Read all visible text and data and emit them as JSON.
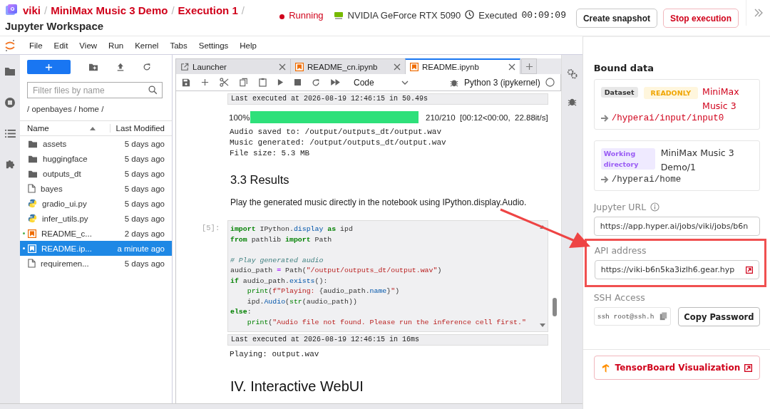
{
  "header": {
    "breadcrumb": [
      {
        "label": "viki",
        "selected": false
      },
      {
        "label": "MiniMax Music 3 Demo",
        "selected": false
      },
      {
        "label": "Execution 1",
        "selected": false
      }
    ],
    "separator": "/",
    "title": "Jupyter Workspace",
    "status": "Running",
    "gpu": "NVIDIA GeForce RTX 5090",
    "executed_label": "Executed",
    "executed_time": "00:09:09",
    "buttons": [
      {
        "label": "Create snapshot",
        "kind": "default"
      },
      {
        "label": "Stop execution",
        "kind": "danger"
      }
    ]
  },
  "menu": [
    "File",
    "Edit",
    "View",
    "Run",
    "Kernel",
    "Tabs",
    "Settings",
    "Help"
  ],
  "file_browser": {
    "filter_placeholder": "Filter files by name",
    "path": "/ openbayes / home /",
    "columns": [
      "Name",
      "Last Modified"
    ],
    "files": [
      {
        "name": "assets",
        "modified": "5 days ago",
        "kind": "folder",
        "selected": false,
        "running": false
      },
      {
        "name": "huggingface",
        "modified": "5 days ago",
        "kind": "folder",
        "selected": false,
        "running": false
      },
      {
        "name": "outputs_dt",
        "modified": "5 days ago",
        "kind": "folder",
        "selected": false,
        "running": false
      },
      {
        "name": "bayes",
        "modified": "5 days ago",
        "kind": "file",
        "selected": false,
        "running": false
      },
      {
        "name": "gradio_ui.py",
        "modified": "5 days ago",
        "kind": "python",
        "selected": false,
        "running": false
      },
      {
        "name": "infer_utils.py",
        "modified": "5 days ago",
        "kind": "python",
        "selected": false,
        "running": false
      },
      {
        "name": "README_c...",
        "modified": "2 days ago",
        "kind": "notebook",
        "selected": false,
        "running": true
      },
      {
        "name": "README.ip...",
        "modified": "a minute ago",
        "kind": "notebook",
        "selected": true,
        "running": true
      },
      {
        "name": "requiremen...",
        "modified": "5 days ago",
        "kind": "file",
        "selected": false,
        "running": false
      }
    ]
  },
  "notebook": {
    "tabs": [
      {
        "label": "Launcher",
        "kind": "launcher",
        "selected": false
      },
      {
        "label": "README_cn.ipynb",
        "kind": "notebook",
        "selected": false
      },
      {
        "label": "README.ipynb",
        "kind": "notebook",
        "selected": true
      }
    ],
    "cell_type": "Code",
    "kernel": "Python 3 (ipykernel)",
    "blocks": [
      {
        "kind": "footer",
        "text": "Last executed at 2026-08-19 12:46:15 in 50.49s"
      },
      {
        "kind": "progress",
        "percent": "100%",
        "level": 1,
        "stats": "210/210  [00:12<00:00,  22.88it/s]"
      },
      {
        "kind": "output",
        "lines": [
          "Audio saved to: /output/outputs_dt/output.wav",
          "Music generated: /output/outputs_dt/output.wav",
          "File size: 5.3 MB"
        ]
      },
      {
        "kind": "heading",
        "text": "3.3 Results"
      },
      {
        "kind": "paragraph",
        "text": "Play the generated music directly in the notebook using IPython.display.Audio."
      },
      {
        "kind": "code",
        "prompt": "[5]:",
        "lines": [
          {
            "kind": "code",
            "tokens": [
              {
                "kind": "kw",
                "text": "import"
              },
              {
                "kind": "plain",
                "text": " IPython."
              },
              {
                "kind": "attr",
                "text": "display"
              },
              {
                "kind": "kw",
                "text": " as"
              },
              {
                "kind": "plain",
                "text": " ipd"
              }
            ]
          },
          {
            "kind": "code",
            "tokens": [
              {
                "kind": "kw",
                "text": "from"
              },
              {
                "kind": "plain",
                "text": " pathlib "
              },
              {
                "kind": "kw",
                "text": "import"
              },
              {
                "kind": "plain",
                "text": " Path"
              }
            ]
          },
          {
            "kind": "blank"
          },
          {
            "kind": "code",
            "tokens": [
              {
                "kind": "comment",
                "text": "# Play generated audio"
              }
            ]
          },
          {
            "kind": "code",
            "tokens": [
              {
                "kind": "plain",
                "text": "audio_path "
              },
              {
                "kind": "op",
                "text": "="
              },
              {
                "kind": "plain",
                "text": " Path("
              },
              {
                "kind": "str",
                "text": "\"/output/outputs_dt/output.wav\""
              },
              {
                "kind": "plain",
                "text": ")"
              }
            ]
          },
          {
            "kind": "code",
            "tokens": [
              {
                "kind": "kw",
                "text": "if"
              },
              {
                "kind": "plain",
                "text": " audio_path."
              },
              {
                "kind": "attr",
                "text": "exists"
              },
              {
                "kind": "plain",
                "text": "():"
              }
            ]
          },
          {
            "kind": "code",
            "tokens": [
              {
                "kind": "builtin",
                "text": "    print"
              },
              {
                "kind": "plain",
                "text": "("
              },
              {
                "kind": "str",
                "text": "f\"Playing: "
              },
              {
                "kind": "plain",
                "text": "{audio_path."
              },
              {
                "kind": "attr",
                "text": "name"
              },
              {
                "kind": "plain",
                "text": "}"
              },
              {
                "kind": "str",
                "text": "\""
              },
              {
                "kind": "plain",
                "text": ")"
              }
            ]
          },
          {
            "kind": "code",
            "tokens": [
              {
                "kind": "plain",
                "text": "    ipd."
              },
              {
                "kind": "attr",
                "text": "Audio"
              },
              {
                "kind": "plain",
                "text": "("
              },
              {
                "kind": "builtin",
                "text": "str"
              },
              {
                "kind": "plain",
                "text": "(audio_path))"
              }
            ]
          },
          {
            "kind": "code",
            "tokens": [
              {
                "kind": "kw",
                "text": "else"
              },
              {
                "kind": "plain",
                "text": ":"
              }
            ]
          },
          {
            "kind": "code",
            "tokens": [
              {
                "kind": "builtin",
                "text": "    print"
              },
              {
                "kind": "plain",
                "text": "("
              },
              {
                "kind": "str",
                "text": "\"Audio file not found. Please run the inference cell first.\""
              }
            ]
          }
        ]
      },
      {
        "kind": "footer",
        "text": "Last executed at 2026-08-19 12:46:15 in 16ms"
      },
      {
        "kind": "output",
        "lines": [
          "Playing: output.wav"
        ]
      },
      {
        "kind": "heading",
        "text": "IV. Interactive WebUI"
      }
    ]
  },
  "panel": {
    "bound_title": "Bound data",
    "bindings": [
      {
        "kind": "dataset",
        "tags": [
          {
            "text": "Dataset",
            "kind": "gray"
          },
          {
            "text": "READONLY",
            "kind": "yellow"
          }
        ],
        "name": "MiniMax Music 3",
        "path": "/hyperai/input/input0"
      },
      {
        "kind": "workdir",
        "tags": [
          {
            "text": "Working directory",
            "kind": "purple"
          }
        ],
        "name": "MiniMax Music 3 Demo/1",
        "path": "/hyperai/home"
      }
    ],
    "jupyter_url": {
      "label": "Jupyter URL",
      "value": "https://app.hyper.ai/jobs/viki/jobs/b6n"
    },
    "api_address": {
      "label": "API address",
      "value": "https://viki-b6n5ka3izlh6.gear.hyp",
      "highlighted": true
    },
    "ssh": {
      "label": "SSH Access",
      "value": "ssh root@ssh.h",
      "button": "Copy Password"
    },
    "tensorboard": "TensorBoard Visualization"
  }
}
